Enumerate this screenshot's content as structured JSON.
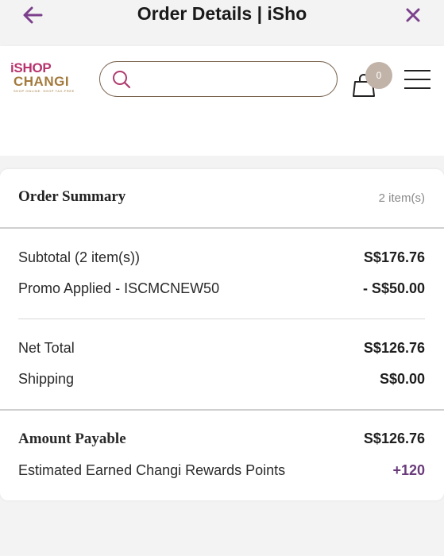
{
  "topbar": {
    "title": "Order Details | iSho"
  },
  "header": {
    "logo": {
      "line1": "iSHOP",
      "line2": "CHANGI",
      "tagline": "SHOP ONLINE. SHOP TAX-FREE"
    },
    "search": {
      "placeholder": "",
      "value": ""
    },
    "cart": {
      "count": "0"
    }
  },
  "summary": {
    "title": "Order Summary",
    "item_count": "2 item(s)",
    "subtotal_label": "Subtotal (2 item(s))",
    "subtotal_value": "S$176.76",
    "promo_label": "Promo Applied - ISCMCNEW50",
    "promo_value": "- S$50.00",
    "net_label": "Net Total",
    "net_value": "S$126.76",
    "shipping_label": "Shipping",
    "shipping_value": "S$0.00",
    "payable_label": "Amount Payable",
    "payable_value": "S$126.76",
    "points_label": "Estimated Earned Changi Rewards Points",
    "points_value": "+120"
  },
  "colors": {
    "accent_purple": "#6a3b7a",
    "brand_pink": "#b7336d",
    "brand_gold": "#a37a3d",
    "badge": "#c2b3a9"
  }
}
